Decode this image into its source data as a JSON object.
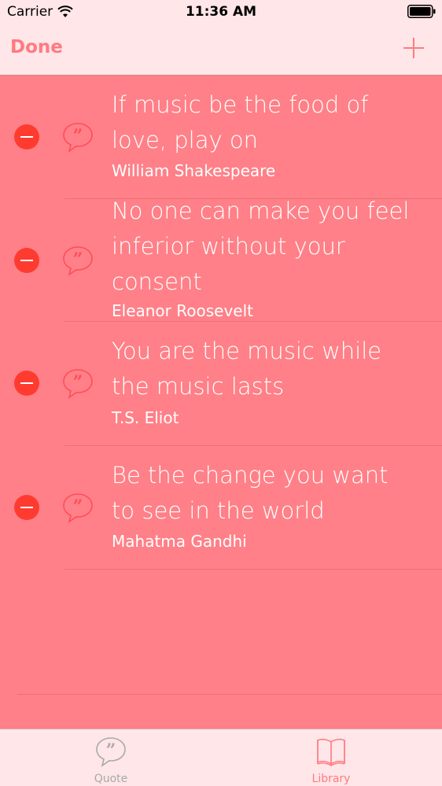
{
  "status_bar": {
    "carrier": "Carrier",
    "time": "11:36 AM"
  },
  "nav": {
    "done_label": "Done"
  },
  "quotes": [
    {
      "text_lines": [
        "If music be the food of",
        "love, play on"
      ],
      "author": "William Shakespeare"
    },
    {
      "text_lines": [
        "No one can make you feel",
        "inferior without your",
        "consent"
      ],
      "author": "Eleanor Roosevelt"
    },
    {
      "text_lines": [
        "You are the music while",
        "the music lasts"
      ],
      "author": "T.S. Eliot"
    },
    {
      "text_lines": [
        "Be the change you want",
        "to see in the world"
      ],
      "author": "Mahatma Gandhi"
    }
  ],
  "tabs": [
    {
      "label": "Quote",
      "icon": "quote-bubble-icon"
    },
    {
      "label": "Library",
      "icon": "book-icon"
    }
  ],
  "colors": {
    "background": "#ff8088",
    "bar_background": "#ffe6e8",
    "accent": "#ff7a82",
    "delete": "#ff3b30"
  }
}
